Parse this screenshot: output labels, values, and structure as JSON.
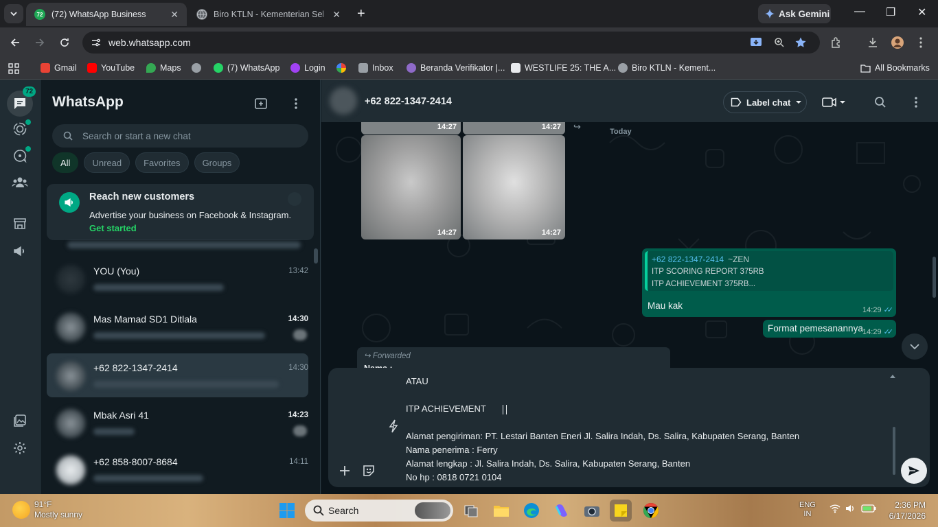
{
  "browser": {
    "tabs": [
      {
        "title": "(72) WhatsApp Business",
        "favicon_text": "72",
        "active": true
      },
      {
        "title": "Biro KTLN - Kementerian Sekretariat Negara",
        "active": false
      }
    ],
    "ask_gemini": "Ask Gemini",
    "url": "web.whatsapp.com",
    "bookmarks": [
      {
        "label": "Gmail",
        "icon": "gmail-icon",
        "color": "#ea4335"
      },
      {
        "label": "YouTube",
        "icon": "youtube-icon",
        "color": "#ff0000"
      },
      {
        "label": "Maps",
        "icon": "maps-icon",
        "color": "#34a853"
      },
      {
        "label": "",
        "icon": "globe-icon",
        "color": "#9aa0a6"
      },
      {
        "label": "(7) WhatsApp",
        "icon": "whatsapp-icon",
        "color": "#25d366"
      },
      {
        "label": "Login",
        "icon": "login-icon",
        "color": "#a142f4"
      },
      {
        "label": "",
        "icon": "photos-icon",
        "color": "#fbbc04"
      },
      {
        "label": "Inbox",
        "icon": "inbox-icon",
        "color": "#9aa0a6"
      },
      {
        "label": "Beranda Verifikator |...",
        "icon": "verifikator-icon",
        "color": "#8e6ac8"
      },
      {
        "label": "WESTLIFE 25: THE A...",
        "icon": "westlife-icon",
        "color": "#e8eaed"
      },
      {
        "label": "Biro KTLN - Kement...",
        "icon": "globe-icon",
        "color": "#9aa0a6"
      }
    ],
    "all_bookmarks": "All Bookmarks"
  },
  "whatsapp": {
    "rail": {
      "unread_badge": "72"
    },
    "sidebar": {
      "title": "WhatsApp",
      "search_placeholder": "Search or start a new chat",
      "filters": [
        {
          "label": "All",
          "active": true
        },
        {
          "label": "Unread",
          "active": false
        },
        {
          "label": "Favorites",
          "active": false
        },
        {
          "label": "Groups",
          "active": false
        }
      ],
      "promo": {
        "title": "Reach new customers",
        "description": "Advertise your business on Facebook & Instagram.",
        "link": "Get started"
      },
      "chats": [
        {
          "name": "YOU (You)",
          "time": "13:42",
          "bold_time": false,
          "selected": false,
          "unread": false
        },
        {
          "name": "Mas Mamad SD1 Ditlala",
          "time": "14:30",
          "bold_time": true,
          "selected": false,
          "unread": true
        },
        {
          "name": "+62 822-1347-2414",
          "time": "14:30",
          "bold_time": false,
          "selected": true,
          "unread": false
        },
        {
          "name": "Mbak Asri 41",
          "time": "14:23",
          "bold_time": true,
          "selected": false,
          "unread": true
        },
        {
          "name": "+62 858-8007-8684",
          "time": "14:11",
          "bold_time": false,
          "selected": false,
          "unread": false
        }
      ]
    },
    "conversation": {
      "contact": "+62 822-1347-2414",
      "label_chat": "Label chat",
      "media_times": [
        "14:27",
        "14:27",
        "14:27",
        "14:27"
      ],
      "date_divider": "Today",
      "quoted_message": {
        "author": "+62 822-1347-2414",
        "author_name": "~ZEN",
        "line1": "ITP SCORING REPORT 375RB",
        "line2": "ITP ACHIEVEMENT 375RB..."
      },
      "messages": [
        {
          "text": "Mau kak",
          "time": "14:29",
          "status": "read"
        },
        {
          "text": "Format pemesanannya",
          "time": "14:29",
          "status": "read"
        }
      ],
      "forwarded": {
        "label": "Forwarded",
        "first_line": "Nama :"
      },
      "composer": {
        "lines": [
          "ATAU",
          "",
          "ITP ACHIEVEMENT",
          "",
          "Alamat pengiriman: PT. Lestari Banten Eneri Jl. Salira Indah, Ds. Salira, Kabupaten Serang, Banten",
          "Nama penerima : Ferry",
          "Alamat lengkap : Jl. Salira Indah, Ds. Salira, Kabupaten Serang, Banten",
          "No hp : 0818 0721 0104"
        ]
      }
    }
  },
  "taskbar": {
    "temperature": "91°F",
    "condition": "Mostly sunny",
    "search": "Search",
    "lang_line1": "ENG",
    "lang_line2": "IN",
    "time": "2:36 PM",
    "date": "6/17/2026"
  }
}
